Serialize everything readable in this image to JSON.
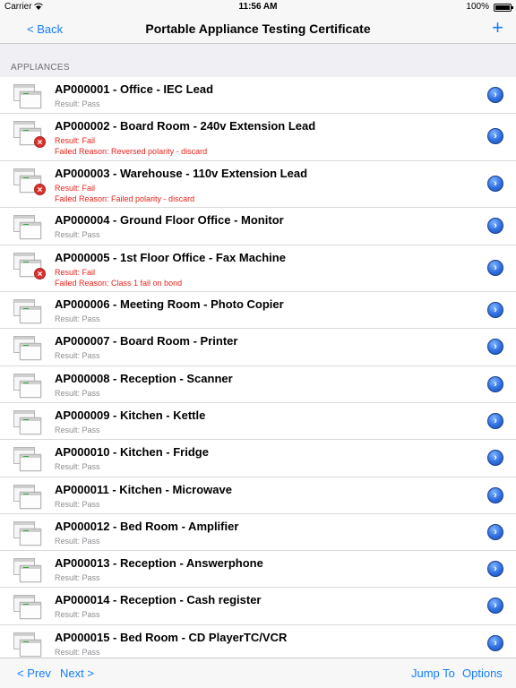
{
  "status_bar": {
    "carrier": "Carrier",
    "time": "11:56 AM",
    "battery": "100%"
  },
  "nav": {
    "back_label": "< Back",
    "title": "Portable Appliance Testing Certificate",
    "add_label": "+"
  },
  "section_header": "APPLIANCES",
  "appliances": [
    {
      "title": "AP000001 - Office - IEC Lead",
      "result": "Result: Pass",
      "failed": false,
      "reason": ""
    },
    {
      "title": "AP000002 - Board Room - 240v Extension Lead",
      "result": "Result: Fail",
      "failed": true,
      "reason": "Failed Reason: Reversed polarity - discard"
    },
    {
      "title": "AP000003 - Warehouse - 110v Extension Lead",
      "result": "Result: Fail",
      "failed": true,
      "reason": "Failed Reason: Failed polarity - discard"
    },
    {
      "title": "AP000004 - Ground Floor Office - Monitor",
      "result": "Result: Pass",
      "failed": false,
      "reason": ""
    },
    {
      "title": "AP000005 - 1st Floor Office - Fax Machine",
      "result": "Result: Fail",
      "failed": true,
      "reason": "Failed Reason: Class 1 fail on bond"
    },
    {
      "title": "AP000006 - Meeting Room - Photo Copier",
      "result": "Result: Pass",
      "failed": false,
      "reason": ""
    },
    {
      "title": "AP000007 - Board Room - Printer",
      "result": "Result: Pass",
      "failed": false,
      "reason": ""
    },
    {
      "title": "AP000008 - Reception - Scanner",
      "result": "Result: Pass",
      "failed": false,
      "reason": ""
    },
    {
      "title": "AP000009 - Kitchen - Kettle",
      "result": "Result: Pass",
      "failed": false,
      "reason": ""
    },
    {
      "title": "AP000010 - Kitchen - Fridge",
      "result": "Result: Pass",
      "failed": false,
      "reason": ""
    },
    {
      "title": "AP000011 - Kitchen - Microwave",
      "result": "Result: Pass",
      "failed": false,
      "reason": ""
    },
    {
      "title": "AP000012 - Bed Room - Amplifier",
      "result": "Result: Pass",
      "failed": false,
      "reason": ""
    },
    {
      "title": "AP000013 - Reception - Answerphone",
      "result": "Result: Pass",
      "failed": false,
      "reason": ""
    },
    {
      "title": "AP000014 - Reception - Cash register",
      "result": "Result: Pass",
      "failed": false,
      "reason": ""
    },
    {
      "title": "AP000015 - Bed Room - CD PlayerTC/VCR",
      "result": "Result: Pass",
      "failed": false,
      "reason": ""
    }
  ],
  "toolbar": {
    "prev_label": "< Prev",
    "next_label": "Next >",
    "jump_label": "Jump To",
    "options_label": "Options"
  },
  "colors": {
    "accent": "#147efb",
    "fail": "#e8231b",
    "pass_text": "#8e8e93"
  },
  "icons": {
    "row_thumb": "appliance-thumbnail-icon",
    "fail_badge": "fail-x-icon",
    "disclosure": "disclosure-chevron-icon"
  }
}
